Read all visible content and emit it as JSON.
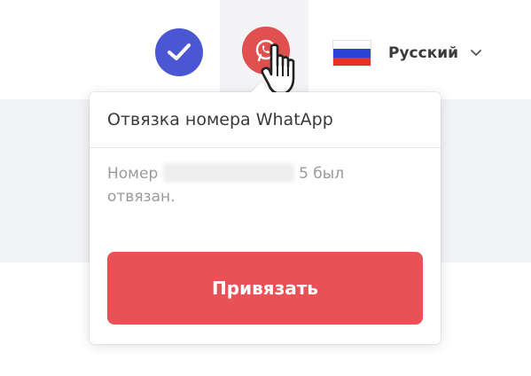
{
  "header": {
    "verify_icon": "check-badge-icon",
    "whatsapp_icon": "whatsapp-icon",
    "language": {
      "label": "Русский",
      "flag": "russia-flag",
      "chevron": "chevron-down-icon"
    },
    "colors": {
      "verify": "#4a56d2",
      "whatsapp": "#e0504f"
    }
  },
  "popover": {
    "title": "Отвязка номера WhatApp",
    "body_prefix": "Номер",
    "body_suffix": "5 был отвязан.",
    "button_label": "Привязать",
    "button_color": "#e85257"
  }
}
